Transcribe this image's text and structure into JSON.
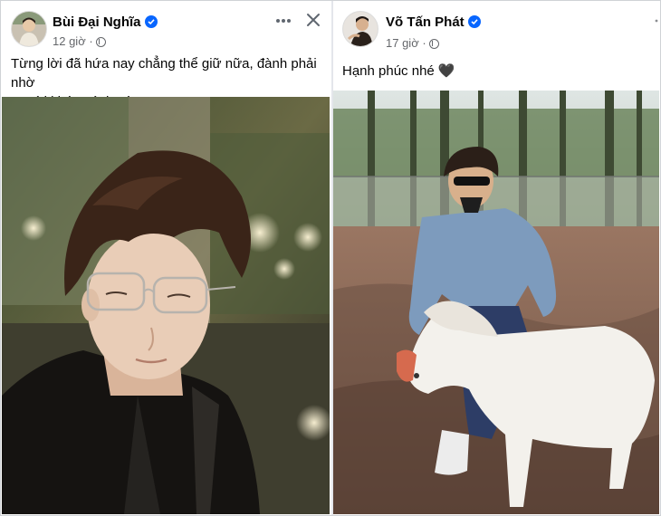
{
  "left_post": {
    "author": "Bùi Đại Nghĩa",
    "time": "12 giờ",
    "separator": "·",
    "text_line1": "Từng lời đã hứa nay chẳng thể giữ nữa, đành phải nhờ",
    "text_line2": "người khác gánh vác....",
    "more_icon": "more-horizontal-icon",
    "close_icon": "close-icon"
  },
  "right_post": {
    "author": "Võ Tấn Phát",
    "time": "17 giờ",
    "separator": "·",
    "text": "Hạnh phúc nhé",
    "emoji": "🖤",
    "more_icon": "more-icon"
  },
  "colors": {
    "verified": "#0866ff",
    "name": "#050505",
    "meta": "#65676b"
  }
}
